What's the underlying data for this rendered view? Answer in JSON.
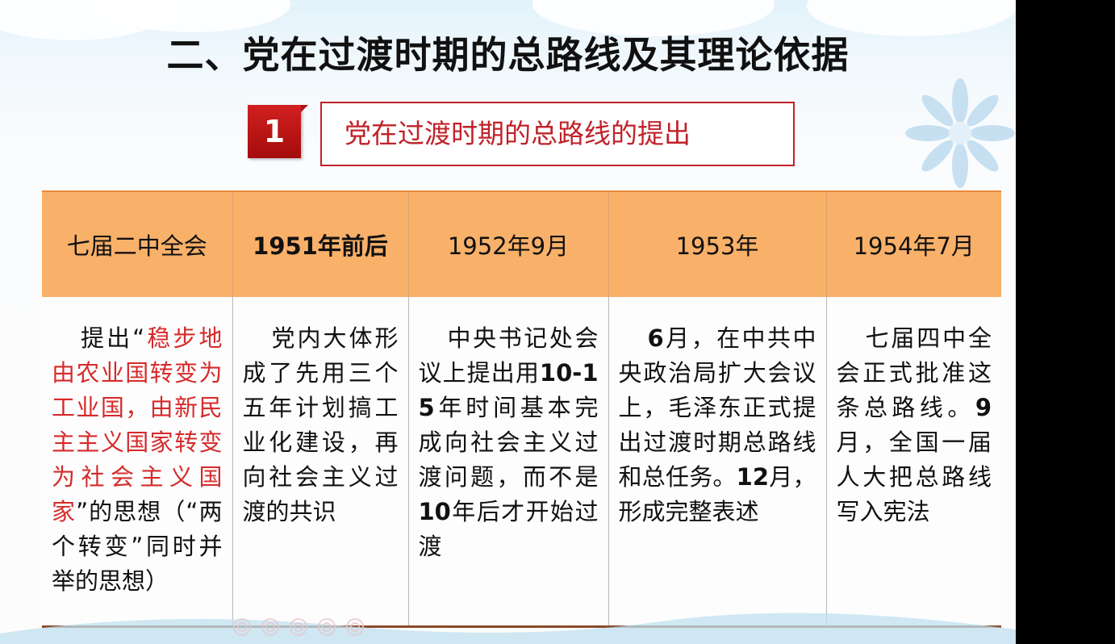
{
  "slide": {
    "title": "二、党在过渡时期的总路线及其理论依据",
    "section_number": "1",
    "section_title": "党在过渡时期的总路线的提出"
  },
  "timeline": {
    "headers": [
      "七届二中全会",
      "1951年前后",
      "1952年9月",
      "1953年",
      "1954年7月"
    ],
    "col0": {
      "t1": "提出“",
      "t2": "稳步地由农业国转变为工业国，由新民主主义国家转变为社会主义国家",
      "t3": "”的思想（“两个转变”同时并举的思想）"
    },
    "col1": "党内大体形成了先用三个五年计划搞工业化建设，再向社会主义过渡的共识",
    "col2": {
      "t1": "中央书记处会议上提出用",
      "n1": "10-15",
      "t2": "年时间基本完成向社会主义过渡问题，而不是",
      "n2": "10",
      "t3": "年后才开始过渡"
    },
    "col3": {
      "n1": "6",
      "t1": "月，在中共中央政治局扩大会议上，毛泽东正式提出过渡时期总路线和总任务。",
      "n2": "12",
      "t2": "月，形成完整表述"
    },
    "col4": {
      "t1": "七届四中全会正式批准这条总路线。",
      "n1": "9",
      "t2": "月，全国一届人大把总路线写入宪法"
    }
  },
  "colors": {
    "accent_red": "#c0222a",
    "highlight_red": "#d62b2b",
    "header_orange": "#f9b069"
  }
}
